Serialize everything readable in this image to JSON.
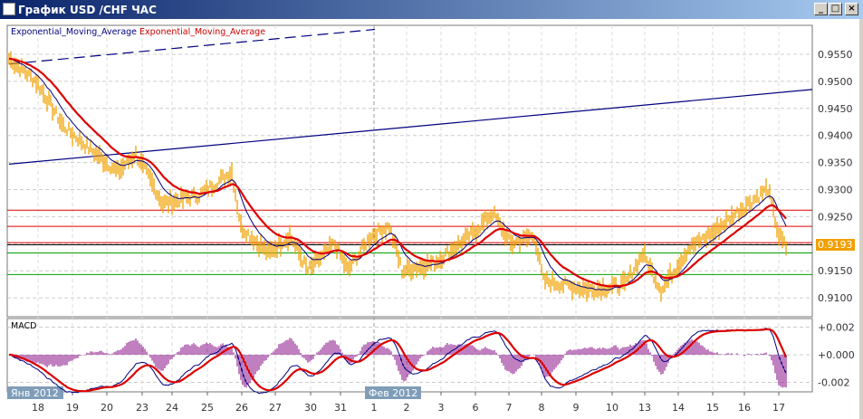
{
  "window": {
    "title": "График USD /CHF  ЧАС",
    "minimize": "_",
    "maximize": "□",
    "close": "×"
  },
  "legend": {
    "ema_fast": "Exponential_Moving_Average",
    "ema_slow": "Exponential_Moving_Average"
  },
  "current_price": "0.9193",
  "macd_label": "MACD",
  "colors": {
    "price": "#f0a000",
    "ema_fast": "#000080",
    "ema_slow": "#dd0000",
    "macd_hist": "#800080",
    "support": "#00a000",
    "resistance": "#dd0000"
  },
  "chart_data": {
    "type": "line",
    "title": "USD/CHF H1",
    "y_ticks": [
      "0.9550",
      "0.9500",
      "0.9450",
      "0.9400",
      "0.9350",
      "0.9300",
      "0.9250",
      "0.9150",
      "0.9100"
    ],
    "ylim": [
      0.9087,
      0.96
    ],
    "macd_ticks": [
      "+0.002",
      "+0.000",
      "-0.002"
    ],
    "macd_ylim": [
      -0.0027,
      0.0027
    ],
    "x_labels": [
      "18",
      "19",
      "20",
      "23",
      "24",
      "25",
      "26",
      "27",
      "30",
      "31",
      "1",
      "2",
      "3",
      "6",
      "7",
      "8",
      "9",
      "10",
      "13",
      "14",
      "15",
      "16",
      "17"
    ],
    "month_labels": [
      {
        "text": "Янв 2012",
        "at": "18"
      },
      {
        "text": "Фев 2012",
        "at": "1"
      }
    ],
    "price_anchors": [
      [
        0,
        0.9542
      ],
      [
        15,
        0.95
      ],
      [
        30,
        0.9417
      ],
      [
        45,
        0.9374
      ],
      [
        60,
        0.9333
      ],
      [
        70,
        0.9366
      ],
      [
        85,
        0.9274
      ],
      [
        105,
        0.929
      ],
      [
        123,
        0.9333
      ],
      [
        128,
        0.9232
      ],
      [
        143,
        0.9182
      ],
      [
        155,
        0.9215
      ],
      [
        165,
        0.915
      ],
      [
        180,
        0.92
      ],
      [
        187,
        0.915
      ],
      [
        200,
        0.9215
      ],
      [
        210,
        0.9232
      ],
      [
        217,
        0.915
      ],
      [
        235,
        0.9165
      ],
      [
        255,
        0.9215
      ],
      [
        267,
        0.9257
      ],
      [
        277,
        0.92
      ],
      [
        290,
        0.9215
      ],
      [
        295,
        0.9132
      ],
      [
        320,
        0.9115
      ],
      [
        340,
        0.9124
      ],
      [
        350,
        0.9182
      ],
      [
        360,
        0.9115
      ],
      [
        375,
        0.919
      ],
      [
        390,
        0.9224
      ],
      [
        405,
        0.9266
      ],
      [
        419,
        0.9302
      ],
      [
        425,
        0.9215
      ],
      [
        429,
        0.9193
      ]
    ],
    "horizontal_levels": {
      "resistance": [
        0.9262,
        0.9232,
        0.9202
      ],
      "black": [
        0.9198
      ],
      "support": [
        0.9183,
        0.9143
      ]
    },
    "trendlines": [
      {
        "style": "dashed",
        "from": [
          0,
          0.9532
        ],
        "to": [
          202,
          0.9596
        ]
      },
      {
        "style": "solid",
        "from": [
          0,
          0.9347
        ],
        "to": [
          445,
          0.9485
        ]
      }
    ]
  }
}
